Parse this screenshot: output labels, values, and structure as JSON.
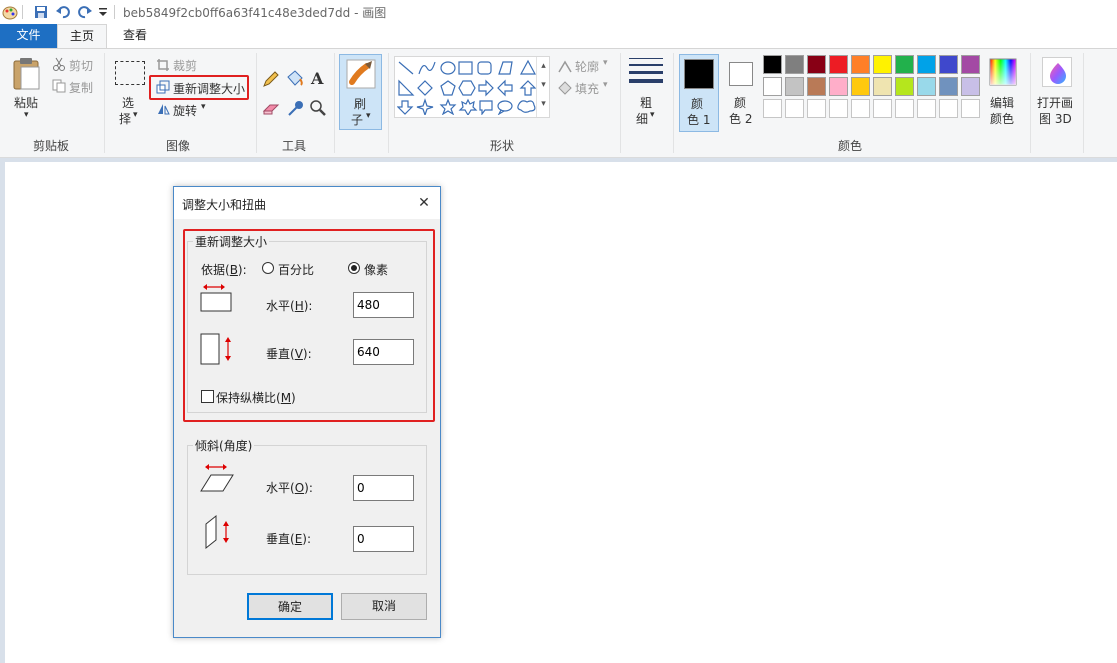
{
  "window": {
    "title": "beb5849f2cb0ff6a63f41c48e3ded7dd - 画图"
  },
  "tabs": {
    "file": "文件",
    "home": "主页",
    "view": "查看"
  },
  "ribbon": {
    "clipboard": {
      "paste": "粘贴",
      "cut": "剪切",
      "copy": "复制",
      "group": "剪贴板"
    },
    "image": {
      "select_1": "选",
      "select_2": "择",
      "crop": "裁剪",
      "resize": "重新调整大小",
      "rotate": "旋转",
      "group": "图像"
    },
    "tools": {
      "group": "工具",
      "text_icon": "A"
    },
    "brush": {
      "label_1": "刷",
      "label_2": "子"
    },
    "shapes": {
      "outline": "轮廓",
      "fill": "填充",
      "group": "形状"
    },
    "size": {
      "label_1": "粗",
      "label_2": "细"
    },
    "colors": {
      "color1_1": "颜",
      "color1_2": "色 1",
      "color2_1": "颜",
      "color2_2": "色 2",
      "edit_1": "编辑",
      "edit_2": "颜色",
      "group": "颜色",
      "palette_row1": [
        "#000000",
        "#7f7f7f",
        "#880015",
        "#ed1c24",
        "#ff7f27",
        "#fff200",
        "#22b14c",
        "#00a2e8",
        "#3f48cc",
        "#a349a4"
      ],
      "palette_row2": [
        "#ffffff",
        "#c3c3c3",
        "#b97a57",
        "#ffaec9",
        "#ffc90e",
        "#efe4b0",
        "#b5e61d",
        "#99d9ea",
        "#7092be",
        "#c8bfe7"
      ]
    },
    "paint3d": {
      "label_1": "打开画",
      "label_2": "图 3D"
    }
  },
  "dialog": {
    "title": "调整大小和扭曲",
    "resize_section": "重新调整大小",
    "by_label": "依据(",
    "by_key": "B",
    "by_suffix": "):",
    "percent": "百分比",
    "pixels": "像素",
    "selected_unit": "像素",
    "horizontal_label": "水平(",
    "horizontal_key": "H",
    "horizontal_suffix": "):",
    "horizontal_value": "480",
    "vertical_label": "垂直(",
    "vertical_key": "V",
    "vertical_suffix": "):",
    "vertical_value": "640",
    "keep_ratio": "保持纵横比(",
    "keep_ratio_key": "M",
    "keep_ratio_suffix": ")",
    "skew_section": "倾斜(角度)",
    "skew_h_label": "水平(",
    "skew_h_key": "O",
    "skew_h_suffix": "):",
    "skew_h_value": "0",
    "skew_v_label": "垂直(",
    "skew_v_key": "E",
    "skew_v_suffix": "):",
    "skew_v_value": "0",
    "ok": "确定",
    "cancel": "取消"
  },
  "highlight_color": "#e02020"
}
